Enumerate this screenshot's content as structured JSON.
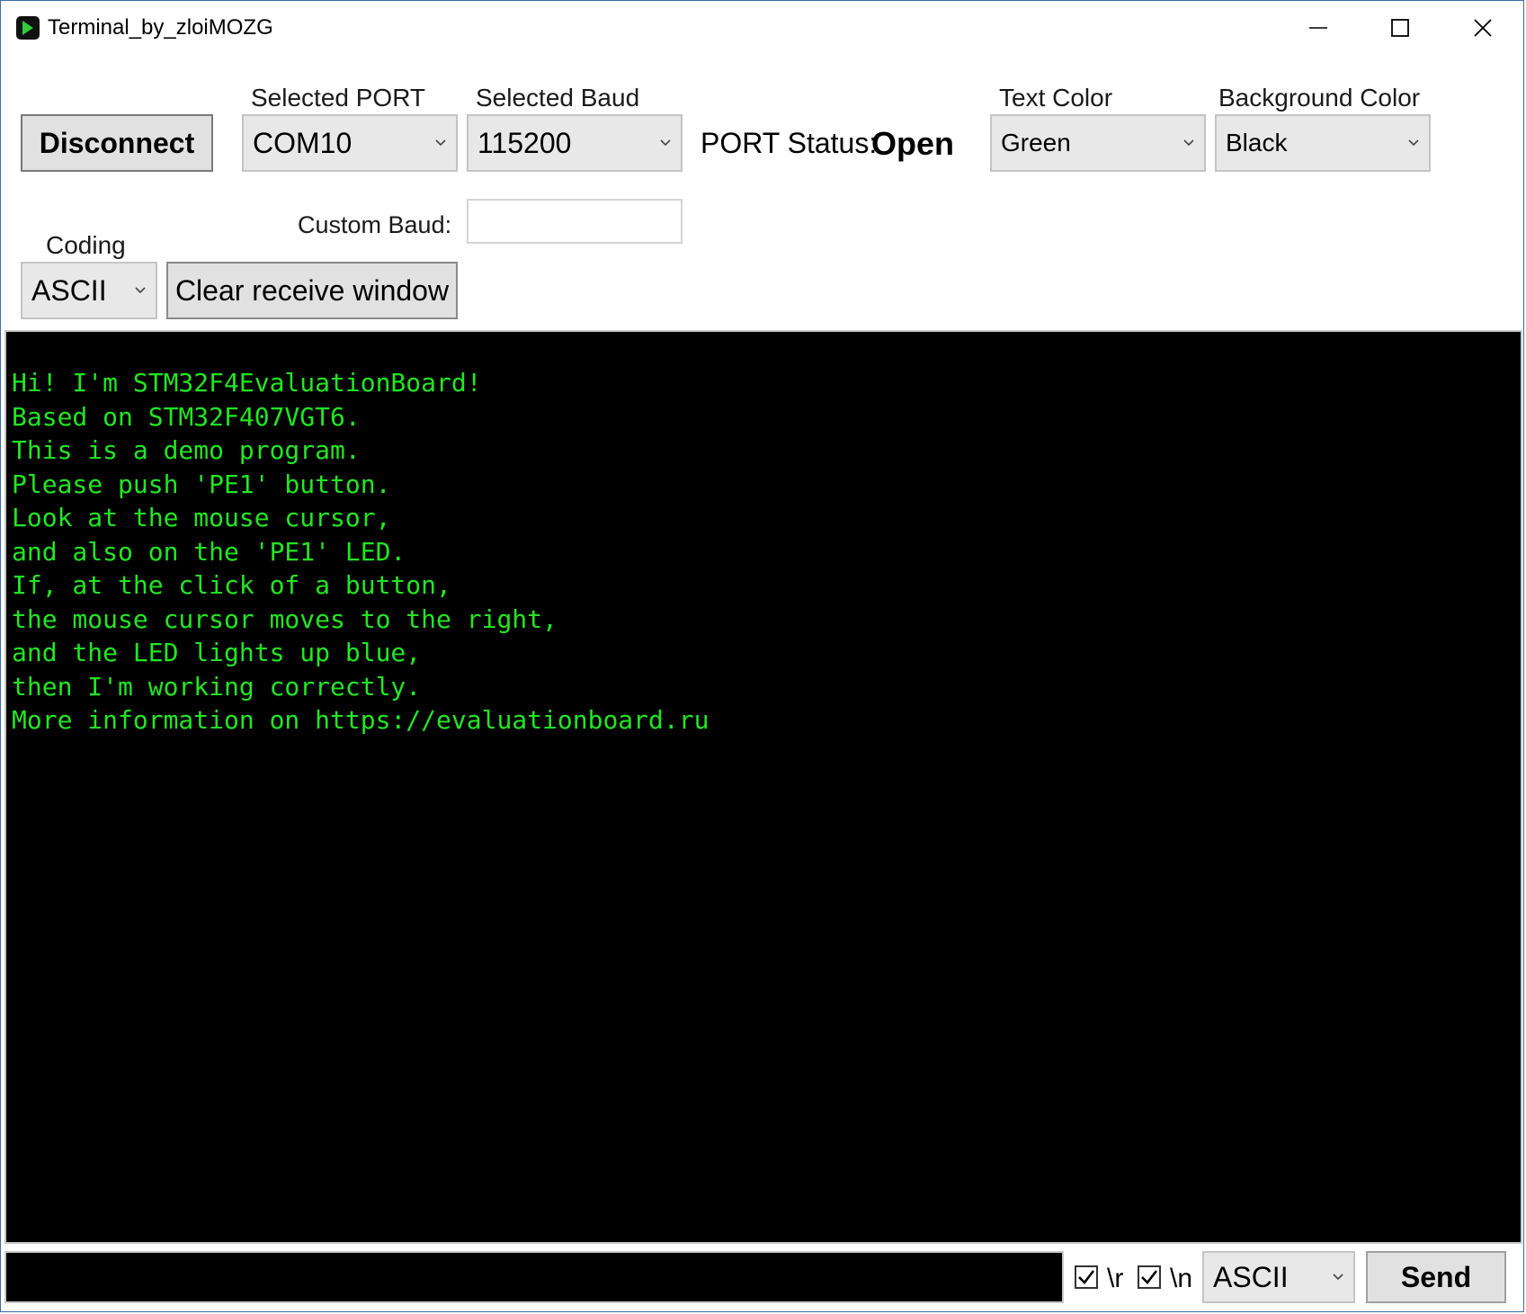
{
  "window": {
    "title": "Terminal_by_zloiMOZG"
  },
  "toolbar": {
    "connect_button": "Disconnect",
    "port_label": "Selected PORT",
    "port_value": "COM10",
    "baud_label": "Selected Baud",
    "baud_value": "115200",
    "status_label": "PORT Status:",
    "status_value": "Open",
    "text_color_label": "Text Color",
    "text_color_value": "Green",
    "bg_color_label": "Background Color",
    "bg_color_value": "Black",
    "custom_baud_label": "Custom Baud:",
    "custom_baud_value": "",
    "coding_label": "Coding",
    "coding_value": "ASCII",
    "clear_button": "Clear receive window"
  },
  "receive": {
    "text_color": "#22e622",
    "background": "#000000",
    "lines": [
      "Hi! I'm STM32F4EvaluationBoard!",
      "Based on STM32F407VGT6.",
      "This is a demo program.",
      "Please push 'PE1' button.",
      "Look at the mouse cursor,",
      "and also on the 'PE1' LED.",
      "If, at the click of a button,",
      "the mouse cursor moves to the right,",
      "and the LED lights up blue,",
      "then I'm working correctly.",
      "More information on https://evaluationboard.ru"
    ]
  },
  "send_bar": {
    "input_value": "",
    "cr_label": "\\r",
    "cr_checked": true,
    "lf_label": "\\n",
    "lf_checked": true,
    "coding_value": "ASCII",
    "send_button": "Send"
  },
  "icons": {
    "app": "terminal-arrow-icon",
    "minimize": "minimize-icon",
    "maximize": "maximize-icon",
    "close": "close-icon"
  }
}
